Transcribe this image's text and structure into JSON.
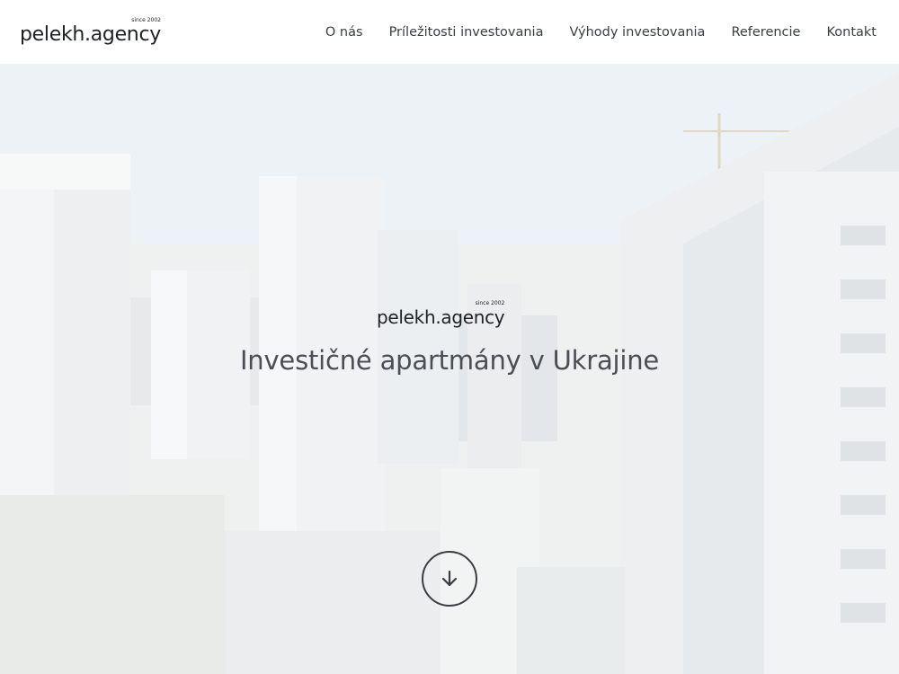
{
  "header": {
    "logo_text": "pelekh.agency",
    "logo_since": "since 2002"
  },
  "nav": {
    "items": [
      {
        "label": "O nás"
      },
      {
        "label": "Príležitosti investovania"
      },
      {
        "label": "Výhody investovania"
      },
      {
        "label": "Referencie"
      },
      {
        "label": "Kontakt"
      }
    ]
  },
  "hero": {
    "logo_text": "pelekh.agency",
    "logo_since": "since 2002",
    "title": "Investičné apartmány v Ukrajine",
    "scroll_icon": "arrow-down-icon"
  },
  "colors": {
    "text_dark": "#1f2124",
    "nav_text": "#3a3d42",
    "hero_title": "#4b4f55"
  }
}
